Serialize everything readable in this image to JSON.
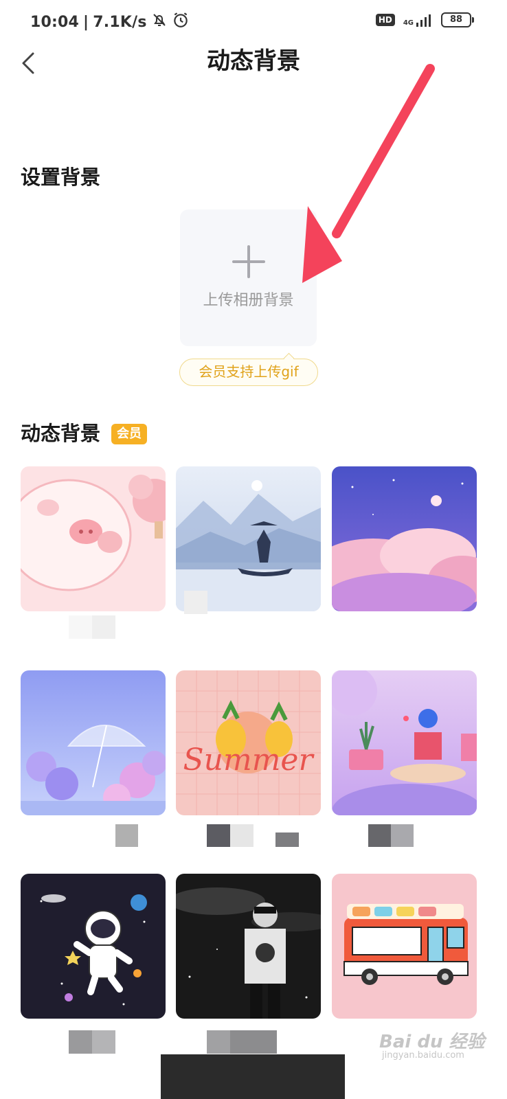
{
  "status_bar": {
    "time": "10:04",
    "net_speed": "7.1K/s",
    "hd": "HD",
    "network": "4G",
    "battery": "88"
  },
  "header": {
    "title": "动态背景"
  },
  "set_background": {
    "title": "设置背景",
    "upload_label": "上传相册背景",
    "gif_note": "会员支持上传gif"
  },
  "dynamic_background": {
    "title": "动态背景",
    "vip_badge": "会员"
  },
  "watermark": {
    "brand": "Bai du 经验",
    "site": "jingyan.baidu.com"
  },
  "colors": {
    "accent_gold": "#f6b024",
    "pill_text": "#e0a21a",
    "arrow_red": "#f4435b"
  }
}
